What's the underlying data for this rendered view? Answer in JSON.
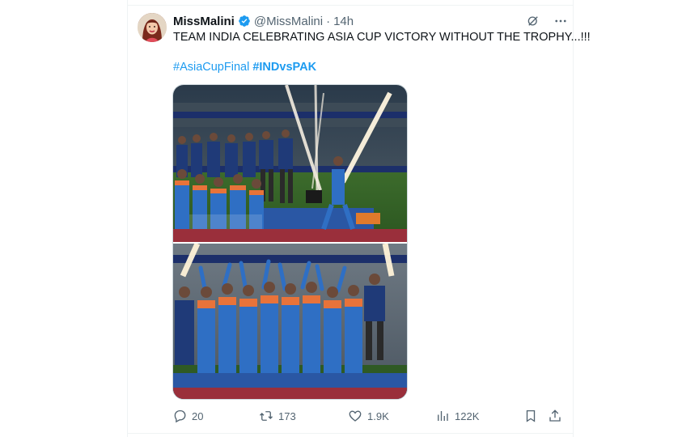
{
  "author": {
    "name": "MissMalini",
    "handle": "@MissMalini",
    "separator": "·",
    "time": "14h"
  },
  "tweet": {
    "text": "TEAM INDIA CELEBRATING ASIA CUP VICTORY WITHOUT THE TROPHY...!!!",
    "hashtags": [
      "#AsiaCupFinal",
      "#INDvsPAK"
    ]
  },
  "actions": {
    "replies": "20",
    "retweets": "173",
    "likes": "1.9K",
    "views": "122K"
  },
  "icons": {
    "verified": "verified-badge-icon",
    "grok": "grok-icon",
    "more": "more-icon",
    "reply": "reply-icon",
    "retweet": "retweet-icon",
    "like": "heart-icon",
    "views": "analytics-icon",
    "bookmark": "bookmark-icon",
    "share": "share-icon"
  },
  "colors": {
    "link": "#1d9bf0",
    "secondary_text": "#536471",
    "primary_text": "#0f1419",
    "jersey_blue": "#1f5fae"
  }
}
